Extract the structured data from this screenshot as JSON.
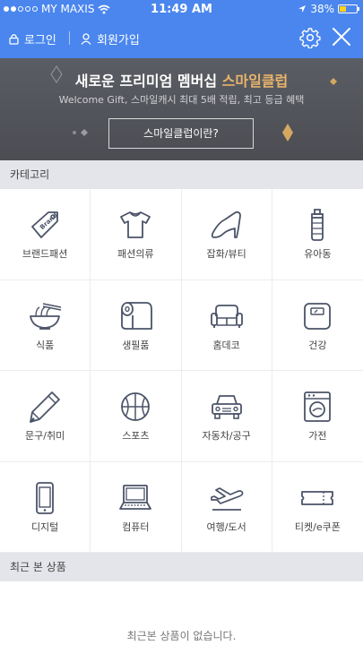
{
  "status_bar": {
    "carrier": "MY MAXIS",
    "time": "11:49 AM",
    "battery": "38%",
    "battery_level": 0.38
  },
  "nav": {
    "login": "로그인",
    "join": "회원가입"
  },
  "banner": {
    "title_prefix": "새로운 프리미엄 멤버십 ",
    "title_highlight": "스마일클럽",
    "subtitle": "Welcome Gift, 스마일캐시 최대 5배 적립, 최고 등급 혜택",
    "button": "스마일클럽이란?",
    "accent_color": "#e6b36b"
  },
  "categories": {
    "header": "카테고리",
    "items": [
      {
        "label": "브랜드패션",
        "icon": "brand-tag-icon"
      },
      {
        "label": "패션의류",
        "icon": "tshirt-icon"
      },
      {
        "label": "잡화/뷰티",
        "icon": "high-heel-icon"
      },
      {
        "label": "유아동",
        "icon": "baby-bottle-icon"
      },
      {
        "label": "식품",
        "icon": "noodle-bowl-icon"
      },
      {
        "label": "생필품",
        "icon": "toilet-paper-icon"
      },
      {
        "label": "홈데코",
        "icon": "sofa-icon"
      },
      {
        "label": "건강",
        "icon": "scale-icon"
      },
      {
        "label": "문구/취미",
        "icon": "pencil-icon"
      },
      {
        "label": "스포츠",
        "icon": "basketball-icon"
      },
      {
        "label": "자동차/공구",
        "icon": "car-icon"
      },
      {
        "label": "가전",
        "icon": "washing-machine-icon"
      },
      {
        "label": "디지털",
        "icon": "smartphone-icon"
      },
      {
        "label": "컴퓨터",
        "icon": "laptop-icon"
      },
      {
        "label": "여행/도서",
        "icon": "airplane-icon"
      },
      {
        "label": "티켓/e쿠폰",
        "icon": "ticket-icon"
      }
    ]
  },
  "recent": {
    "header": "최근 본 상품",
    "empty": "최근본 상품이 없습니다."
  },
  "colors": {
    "brand_blue": "#4a86ee",
    "icon_stroke": "#4b5368"
  }
}
